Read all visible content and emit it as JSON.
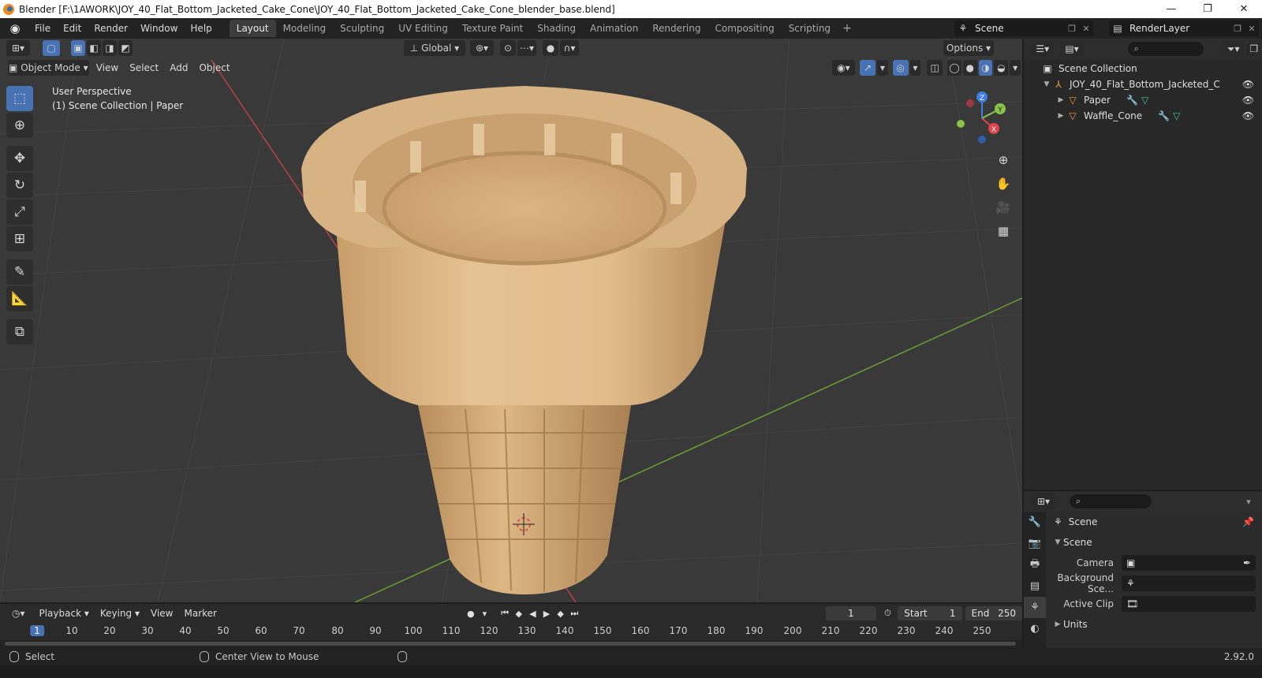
{
  "window": {
    "title": "Blender [F:\\1AWORK\\JOY_40_Flat_Bottom_Jacketed_Cake_Cone\\JOY_40_Flat_Bottom_Jacketed_Cake_Cone_blender_base.blend]",
    "minimize": "—",
    "maximize": "❐",
    "close": "✕"
  },
  "menu": [
    "File",
    "Edit",
    "Render",
    "Window",
    "Help"
  ],
  "workspaces": [
    "Layout",
    "Modeling",
    "Sculpting",
    "UV Editing",
    "Texture Paint",
    "Shading",
    "Animation",
    "Rendering",
    "Compositing",
    "Scripting"
  ],
  "workspace_add": "+",
  "scene_selector": "Scene",
  "view_layer": "RenderLayer",
  "viewport": {
    "transform_orientation": "Global",
    "options": "Options",
    "mode": "Object Mode",
    "header_menus": [
      "View",
      "Select",
      "Add",
      "Object"
    ],
    "info_line1": "User Perspective",
    "info_line2": "(1) Scene Collection | Paper",
    "gizmo_axes": [
      "Z",
      "Y",
      "X"
    ]
  },
  "outliner": {
    "root": "Scene Collection",
    "collection": "JOY_40_Flat_Bottom_Jacketed_C",
    "objects": [
      "Paper",
      "Waffle_Cone"
    ]
  },
  "properties": {
    "context": "Scene",
    "panel_scene": "Scene",
    "camera_label": "Camera",
    "background_label": "Background Sce...",
    "active_clip_label": "Active Clip",
    "panel_units": "Units"
  },
  "timeline": {
    "menus": [
      "Playback",
      "Keying",
      "View",
      "Marker"
    ],
    "current_frame": "1",
    "start_label": "Start",
    "start": "1",
    "end_label": "End",
    "end": "250",
    "ruler_current": "1",
    "ruler_ticks": [
      "10",
      "20",
      "30",
      "40",
      "50",
      "60",
      "70",
      "80",
      "90",
      "100",
      "110",
      "120",
      "130",
      "140",
      "150",
      "160",
      "170",
      "180",
      "190",
      "200",
      "210",
      "220",
      "230",
      "240",
      "250"
    ]
  },
  "status": {
    "left": "Select",
    "middle": "Center View to Mouse",
    "version": "2.92.0"
  },
  "colors": {
    "accent": "#4772b3",
    "axis_x": "#e0444f",
    "axis_y": "#8bc34a",
    "axis_z": "#3d7fe0"
  }
}
